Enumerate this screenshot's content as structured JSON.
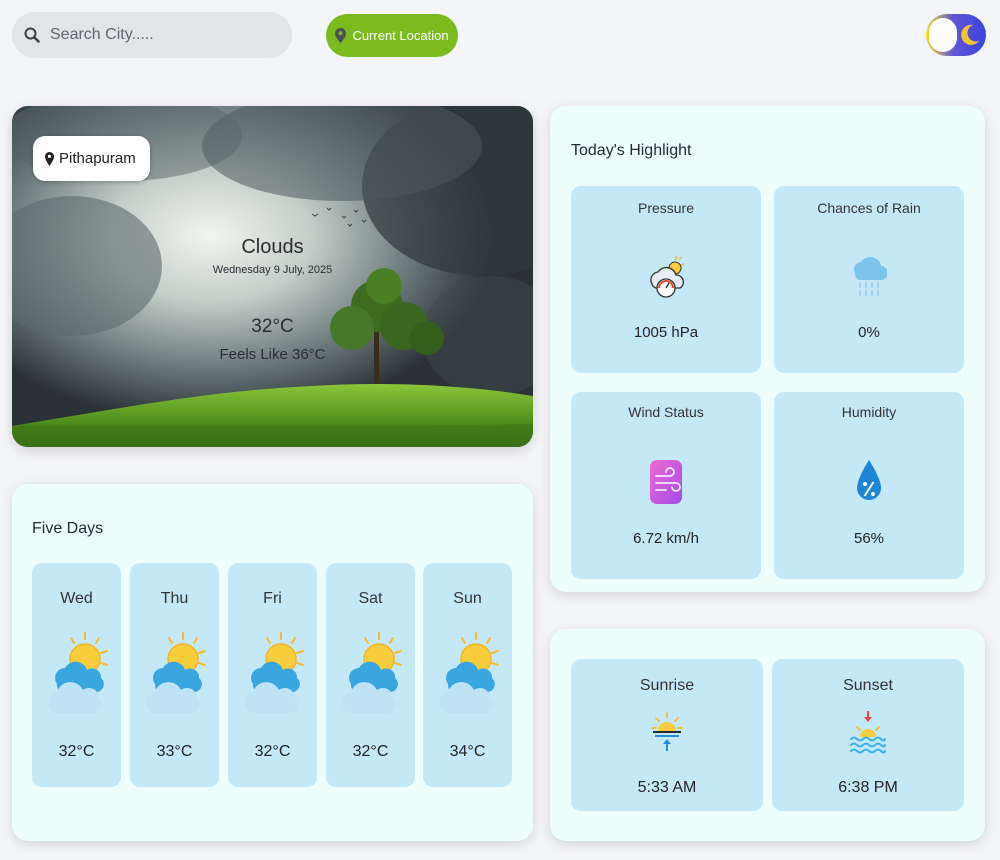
{
  "search": {
    "placeholder": "Search City....."
  },
  "location_button": {
    "label": "Current Location"
  },
  "theme_toggle": {
    "state": "light",
    "icons": [
      "sun-knob",
      "moon-icon"
    ]
  },
  "current": {
    "city": "Pithapuram",
    "condition": "Clouds",
    "date": "Wednesday 9 July, 2025",
    "temperature": "32°C",
    "feels_like": "Feels Like 36°C"
  },
  "forecast": {
    "title": "Five Days",
    "days": [
      {
        "day": "Wed",
        "temp": "32°C",
        "icon": "sun-cloud-icon"
      },
      {
        "day": "Thu",
        "temp": "33°C",
        "icon": "sun-cloud-icon"
      },
      {
        "day": "Fri",
        "temp": "32°C",
        "icon": "sun-cloud-icon"
      },
      {
        "day": "Sat",
        "temp": "32°C",
        "icon": "sun-cloud-icon"
      },
      {
        "day": "Sun",
        "temp": "34°C",
        "icon": "sun-cloud-icon"
      }
    ]
  },
  "highlights": {
    "title": "Today's Highlight",
    "pressure": {
      "label": "Pressure",
      "value": "1005 hPa",
      "icon": "pressure-icon"
    },
    "rain": {
      "label": "Chances of Rain",
      "value": "0%",
      "icon": "rain-cloud-icon"
    },
    "wind": {
      "label": "Wind Status",
      "value": "6.72 km/h",
      "icon": "wind-icon"
    },
    "humidity": {
      "label": "Humidity",
      "value": "56%",
      "icon": "humidity-drop-icon"
    }
  },
  "sun": {
    "sunrise": {
      "label": "Sunrise",
      "value": "5:33 AM",
      "icon": "sunrise-icon"
    },
    "sunset": {
      "label": "Sunset",
      "value": "6:38 PM",
      "icon": "sunset-icon"
    }
  },
  "colors": {
    "accent_green": "#7cbb1d",
    "card_bg": "#edfefd",
    "tile_bg": "#c5e8f7"
  }
}
